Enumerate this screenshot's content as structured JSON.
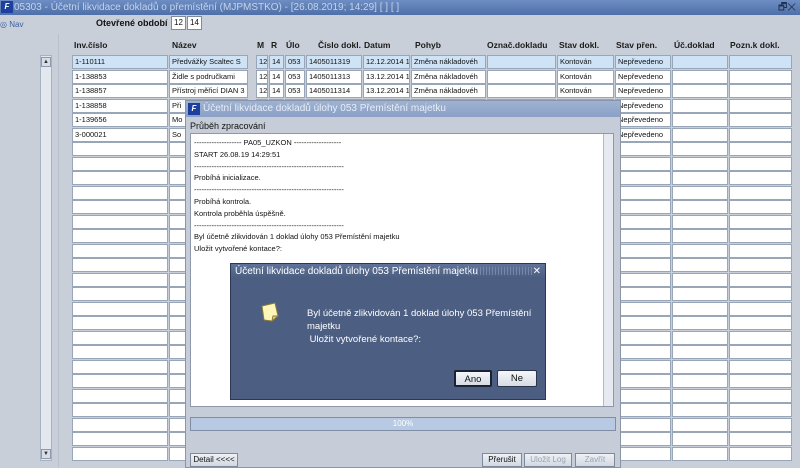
{
  "window": {
    "title": "05303 - Účetní likvidace dokladů o přemístění (MJPMSTKO) - [26.08.2019; 14:29]  [ ]  [ ]",
    "controls": "🗗✕"
  },
  "nav": {
    "label": "Nav"
  },
  "period": {
    "label": "Otevřené období",
    "values": [
      "12",
      "14"
    ]
  },
  "table": {
    "headers": [
      "Inv.číslo",
      "Název",
      "M",
      "R",
      "Úlo",
      "Číslo dokl.",
      "Datum",
      "Pohyb",
      "Označ.dokladu",
      "Stav dokl.",
      "Stav přen.",
      "Úč.doklad",
      "Pozn.k dokl."
    ],
    "rows": [
      {
        "inv": "1-110111",
        "nazev": "Předvážky Scaltec S",
        "m": "12",
        "r": "14",
        "ulo": "053",
        "cislo": "1405011319",
        "datum": "12.12.2014 1",
        "pohyb": "Změna nákladovéh",
        "oznac": "",
        "stav": "Kontován",
        "stavp": "Nepřevedeno",
        "ucd": "",
        "pozn": ""
      },
      {
        "inv": "1-138853",
        "nazev": "Židle s područkami",
        "m": "12",
        "r": "14",
        "ulo": "053",
        "cislo": "1405011313",
        "datum": "13.12.2014 1",
        "pohyb": "Změna nákladovéh",
        "oznac": "",
        "stav": "Kontován",
        "stavp": "Nepřevedeno",
        "ucd": "",
        "pozn": ""
      },
      {
        "inv": "1-138857",
        "nazev": "Přístroj měřicí DIAN 3",
        "m": "12",
        "r": "14",
        "ulo": "053",
        "cislo": "1405011314",
        "datum": "13.12.2014 1",
        "pohyb": "Změna nákladovéh",
        "oznac": "",
        "stav": "Kontován",
        "stavp": "Nepřevedeno",
        "ucd": "",
        "pozn": ""
      },
      {
        "inv": "1-138858",
        "nazev": "Při",
        "m": "",
        "r": "",
        "ulo": "",
        "cislo": "",
        "datum": "",
        "pohyb": "",
        "oznac": "",
        "stav": "",
        "stavp": "Nepřevedeno",
        "ucd": "",
        "pozn": ""
      },
      {
        "inv": "1-139656",
        "nazev": "Mo",
        "m": "",
        "r": "",
        "ulo": "",
        "cislo": "",
        "datum": "",
        "pohyb": "",
        "oznac": "",
        "stav": "",
        "stavp": "Nepřevedeno",
        "ucd": "",
        "pozn": ""
      },
      {
        "inv": "3-000021",
        "nazev": "So",
        "m": "",
        "r": "",
        "ulo": "",
        "cislo": "",
        "datum": "",
        "pohyb": "",
        "oznac": "",
        "stav": "",
        "stavp": "Nepřevedeno",
        "ucd": "",
        "pozn": ""
      }
    ]
  },
  "progress": {
    "title": "Účetní likvidace dokladů úlohy 053 Přemístění majetku",
    "subtitle": "Průběh zpracování",
    "log": [
      "------------------- PA05_UZKON -------------------",
      "START 26.08.19 14:29:51",
      "------------------------------------------------------------",
      "Probíhá inicializace.",
      "------------------------------------------------------------",
      "Probíhá kontrola.",
      "Kontrola proběhla úspěšně.",
      "------------------------------------------------------------",
      "Byl účetně zlikvidován 1 doklad úlohy 053 Přemístění majetku",
      " Uložit vytvořené kontace?:"
    ],
    "percent": "100%",
    "percent_value": 1.0,
    "buttons": {
      "detail": "Detail <<<<",
      "stop": "Přerušit",
      "save_log": "Uložit Log",
      "close": "Zavřít"
    }
  },
  "dialog": {
    "title": "Účetní likvidace dokladů úlohy 053 Přemístění majetku",
    "close": "✕",
    "message": [
      "Byl účetně zlikvidován 1 doklad úlohy 053 Přemístění",
      "majetku",
      " Uložit vytvořené kontace?:"
    ],
    "yes": "Ano",
    "no": "Ne"
  }
}
